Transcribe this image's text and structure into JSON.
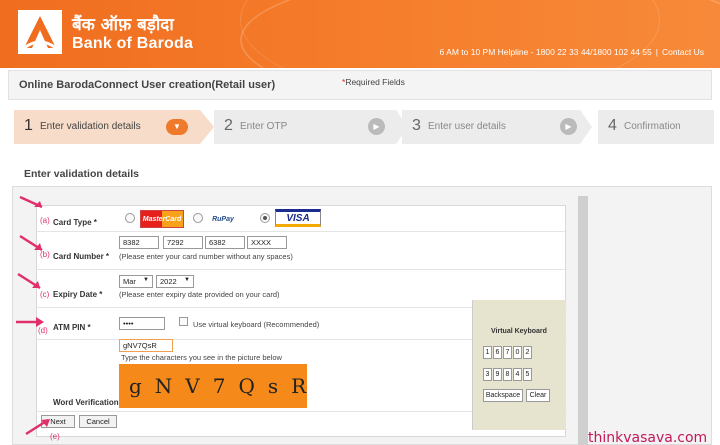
{
  "header": {
    "brand_hindi": "बैंक ऑफ़ बड़ौदा",
    "brand_english": "Bank of Baroda",
    "helpline": "6 AM to 10 PM Helpline - 1800 22 33 44/1800 102 44 55",
    "contact": "Contact Us",
    "colors": {
      "primary": "#f06d1f",
      "logo_red": "#e63a12"
    }
  },
  "titlebar": {
    "title": "Online BarodaConnect User creation(Retail user)",
    "required_star": "*",
    "required_text": "Required Fields"
  },
  "steps": [
    {
      "num": "1",
      "label": "Enter validation details",
      "active": true
    },
    {
      "num": "2",
      "label": "Enter OTP",
      "active": false
    },
    {
      "num": "3",
      "label": "Enter user details",
      "active": false
    },
    {
      "num": "4",
      "label": "Confirmation",
      "active": false
    }
  ],
  "section_title": "Enter validation details",
  "form": {
    "card_type": {
      "marker": "(a)",
      "label": "Card Type",
      "star": "*",
      "options": [
        {
          "name": "MasterCard",
          "selected": false
        },
        {
          "name": "RuPay",
          "selected": false
        },
        {
          "name": "VISA",
          "selected": true
        }
      ]
    },
    "card_number": {
      "marker": "(b)",
      "label": "Card Number",
      "star": "*",
      "parts": [
        "8382",
        "7292",
        "6382",
        "XXXX"
      ],
      "hint": "(Please enter your card number without any spaces)"
    },
    "expiry_date": {
      "marker": "(c)",
      "label": "Expiry Date",
      "star": "*",
      "month": "Mar",
      "year": "2022",
      "hint": "(Please enter expiry date provided on your card)"
    },
    "atm_pin": {
      "marker": "(d)",
      "label": "ATM PIN",
      "star": "*",
      "value": "••••",
      "virtual_keyboard_label": "Use virtual keyboard (Recommended)"
    },
    "word_verification": {
      "label": "Word Verification",
      "star": "*",
      "value": "gNV7QsR",
      "hint": "Type the characters you see in the picture below",
      "captcha_text": "gNV7QsR"
    },
    "buttons": {
      "marker": "(e)",
      "next": "Next",
      "cancel": "Cancel"
    }
  },
  "virtual_keyboard": {
    "title": "Virtual Keyboard",
    "row1": [
      "1",
      "6",
      "7",
      "0",
      "2"
    ],
    "row2": [
      "3",
      "9",
      "8",
      "4",
      "5"
    ],
    "backspace": "Backspace",
    "clear": "Clear"
  },
  "watermark": "thinkvasava.com"
}
